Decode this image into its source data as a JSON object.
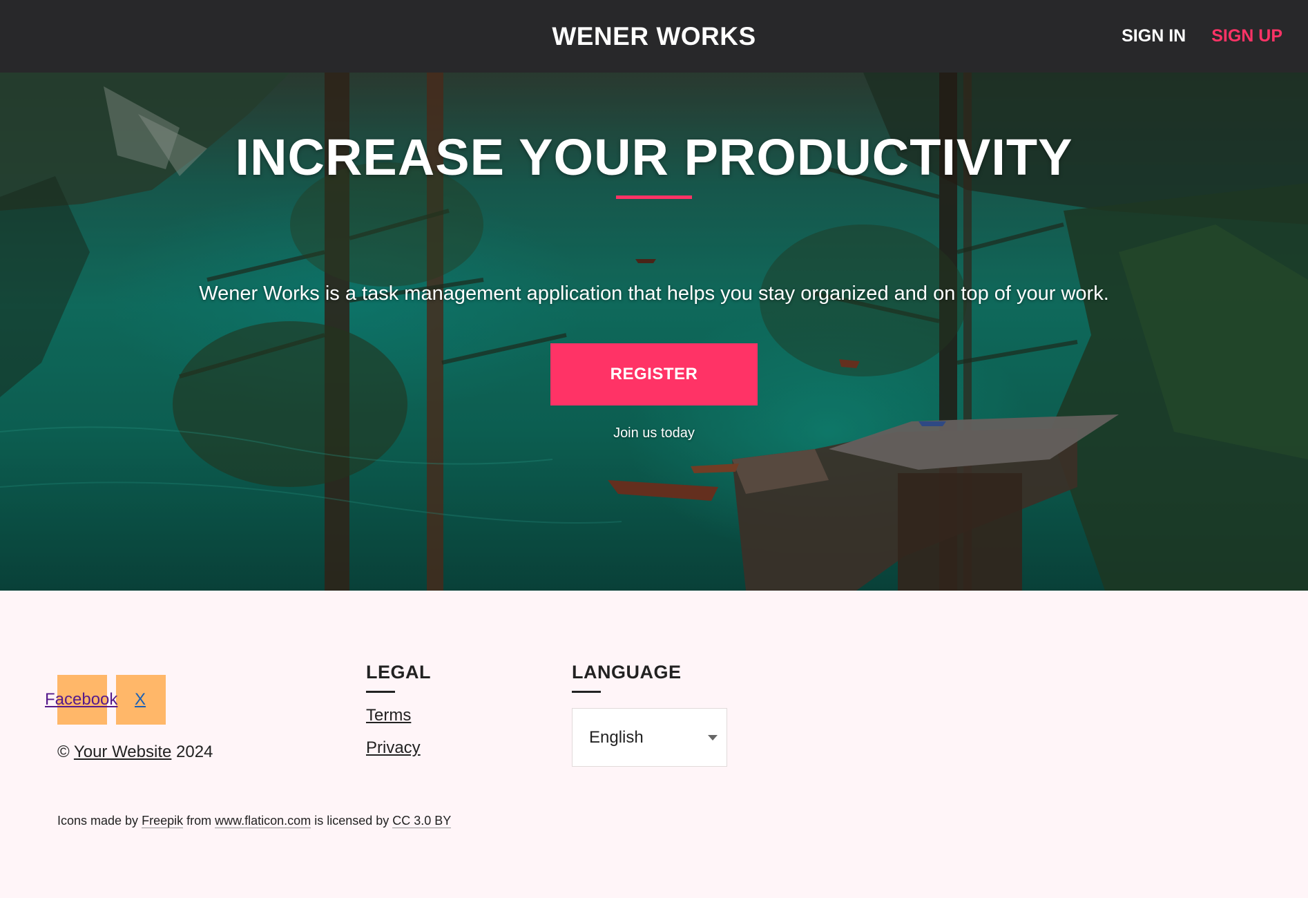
{
  "header": {
    "brand": "WENER WORKS",
    "nav": {
      "sign_in": "SIGN IN",
      "sign_up": "SIGN UP"
    },
    "colors": {
      "bar": "#28282a",
      "accent": "#ff3366"
    }
  },
  "hero": {
    "title": "INCREASE YOUR PRODUCTIVITY",
    "subtitle": "Wener Works is a task management application that helps you stay organized and on top of your work.",
    "register_label": "REGISTER",
    "note": "Join us today"
  },
  "footer": {
    "social": {
      "facebook_label": "Facebook",
      "x_label": "X"
    },
    "copyright": {
      "symbol": "©",
      "site_link": "Your Website",
      "year": "2024"
    },
    "legal": {
      "title": "LEGAL",
      "links": [
        "Terms",
        "Privacy"
      ]
    },
    "language": {
      "title": "LANGUAGE",
      "selected": "English"
    },
    "credits": {
      "prefix": "Icons made by",
      "author": "Freepik",
      "from": "from",
      "site": "www.flaticon.com",
      "licensed": "is licensed by",
      "license": "CC 3.0 BY"
    }
  }
}
